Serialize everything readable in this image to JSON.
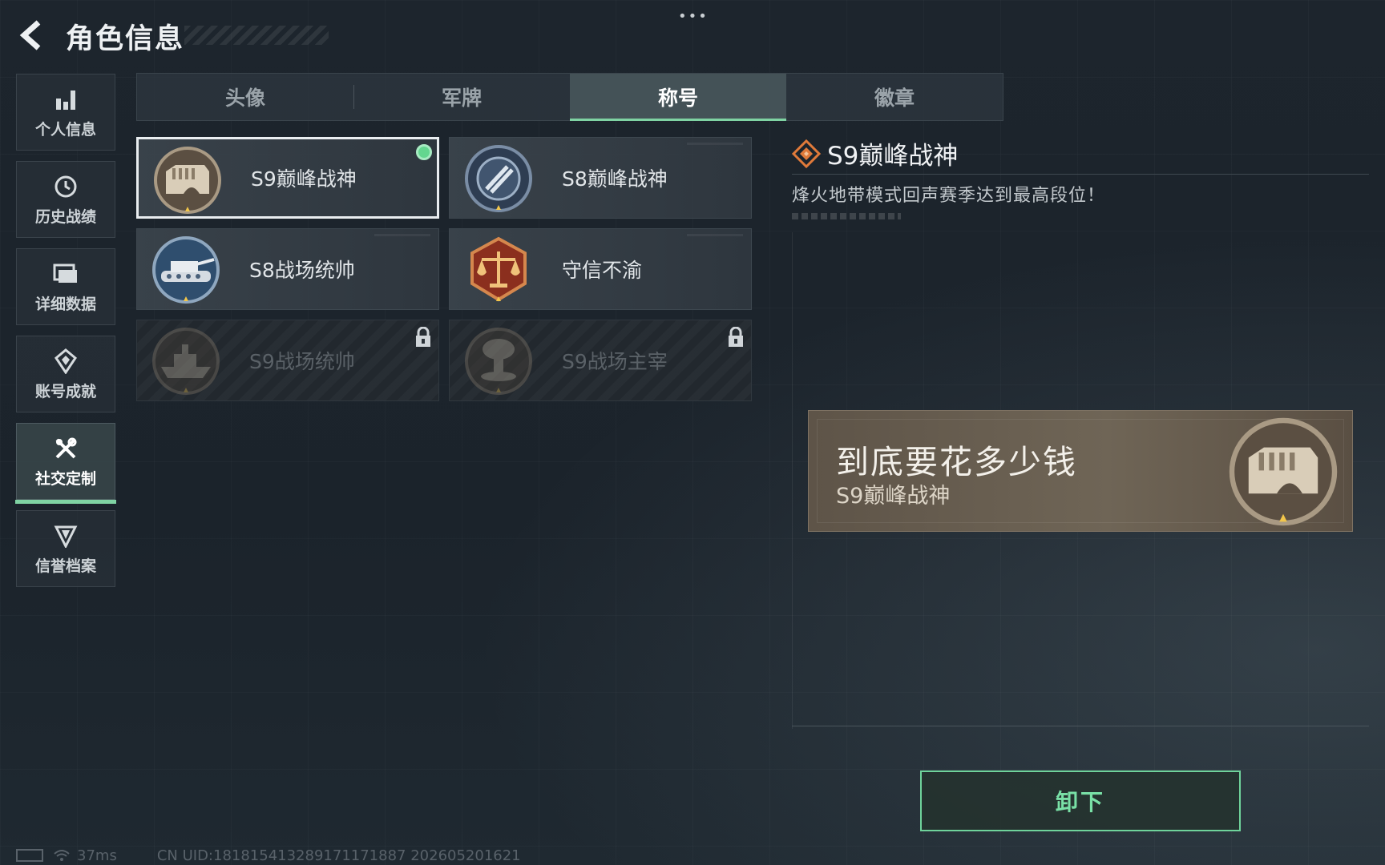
{
  "header": {
    "title": "角色信息",
    "more_label": "•••"
  },
  "sidebar": {
    "items": [
      {
        "label": "个人信息",
        "icon": "bar-chart-icon"
      },
      {
        "label": "历史战绩",
        "icon": "history-clock-icon"
      },
      {
        "label": "详细数据",
        "icon": "folder-icon"
      },
      {
        "label": "账号成就",
        "icon": "achievement-icon"
      },
      {
        "label": "社交定制",
        "icon": "tools-icon",
        "active": true
      },
      {
        "label": "信誉档案",
        "icon": "credit-shield-icon"
      }
    ]
  },
  "tabs": [
    {
      "label": "头像"
    },
    {
      "label": "军牌"
    },
    {
      "label": "称号",
      "active": true
    },
    {
      "label": "徽章"
    }
  ],
  "titles": [
    {
      "label": "S9巅峰战神",
      "medal": "fortress-medal",
      "selected": true,
      "equipped": true,
      "locked": false
    },
    {
      "label": "S8巅峰战神",
      "medal": "blue-emblem-medal",
      "selected": false,
      "equipped": false,
      "locked": false
    },
    {
      "label": "S8战场统帅",
      "medal": "tank-medal",
      "selected": false,
      "equipped": false,
      "locked": false
    },
    {
      "label": "守信不渝",
      "medal": "scales-medal",
      "selected": false,
      "equipped": false,
      "locked": false
    },
    {
      "label": "S9战场统帅",
      "medal": "warship-medal",
      "selected": false,
      "equipped": false,
      "locked": true
    },
    {
      "label": "S9战场主宰",
      "medal": "mushroom-cloud-medal",
      "selected": false,
      "equipped": false,
      "locked": true
    }
  ],
  "detail": {
    "name": "S9巅峰战神",
    "description": "烽火地带模式回声赛季达到最高段位！"
  },
  "nameplate": {
    "player_name": "到底要花多少钱",
    "title": "S9巅峰战神"
  },
  "actions": {
    "unequip_label": "卸下"
  },
  "status": {
    "ping": "37ms",
    "uid": "CN UID:181815413289171171887 202605201621"
  },
  "colors": {
    "accent_green": "#7fd3a3",
    "equipped_dot": "#63d68f",
    "diamond_orange": "#e07a3a"
  }
}
